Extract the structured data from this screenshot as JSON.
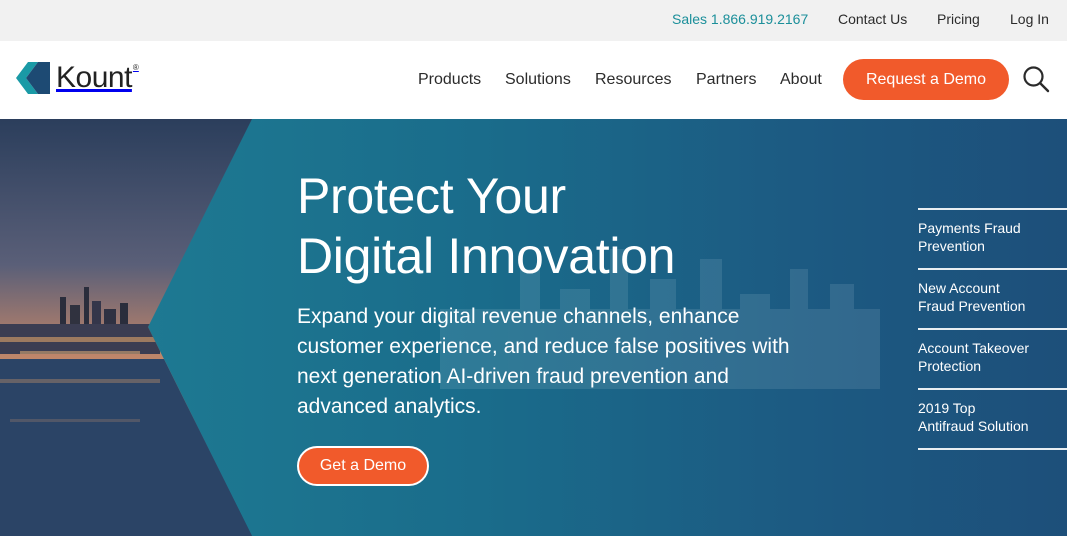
{
  "utility_bar": {
    "sales": "Sales 1.866.919.2167",
    "contact": "Contact Us",
    "pricing": "Pricing",
    "login": "Log In"
  },
  "header": {
    "logo_text": "Kount",
    "logo_mark": "®",
    "nav": [
      "Products",
      "Solutions",
      "Resources",
      "Partners",
      "About"
    ],
    "cta": "Request a Demo",
    "search_icon": "search-icon"
  },
  "hero": {
    "title_lines": [
      "Protect Your",
      "Digital Innovation"
    ],
    "subtitle_lines": [
      "Expand your digital revenue channels, enhance",
      "customer experience, and reduce false positives with",
      "next generation AI-driven fraud prevention and",
      "advanced analytics."
    ],
    "cta": "Get a Demo",
    "side_links": [
      [
        "Payments Fraud",
        "Prevention"
      ],
      [
        "New Account",
        "Fraud Prevention"
      ],
      [
        "Account Takeover",
        "Protection"
      ],
      [
        "2019 Top",
        "Antifraud Solution"
      ]
    ]
  },
  "colors": {
    "accent": "#f15a2b",
    "teal": "#1b8f9a",
    "hero_blue": "#1c5a82",
    "logo_dark": "#1d4a73",
    "logo_teal": "#1a9aa6"
  }
}
